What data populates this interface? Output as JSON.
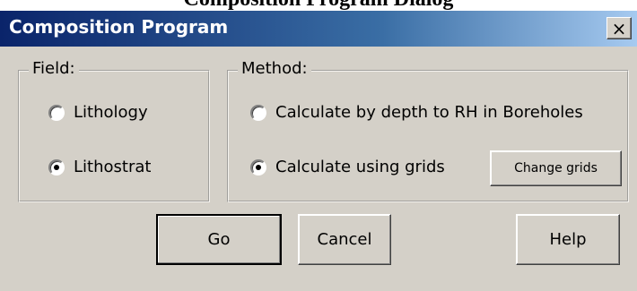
{
  "caption": "Composition Program Dialog",
  "window": {
    "title": "Composition Program",
    "close_glyph": "×"
  },
  "field_group": {
    "legend": "Field:",
    "options": [
      {
        "label": "Lithology",
        "checked": false
      },
      {
        "label": "Lithostrat",
        "checked": true
      }
    ]
  },
  "method_group": {
    "legend": "Method:",
    "options": [
      {
        "label": "Calculate by depth to RH in Boreholes",
        "checked": false
      },
      {
        "label": "Calculate using grids",
        "checked": true
      }
    ],
    "change_grids_label": "Change grids"
  },
  "buttons": {
    "go": "Go",
    "cancel": "Cancel",
    "help": "Help"
  }
}
